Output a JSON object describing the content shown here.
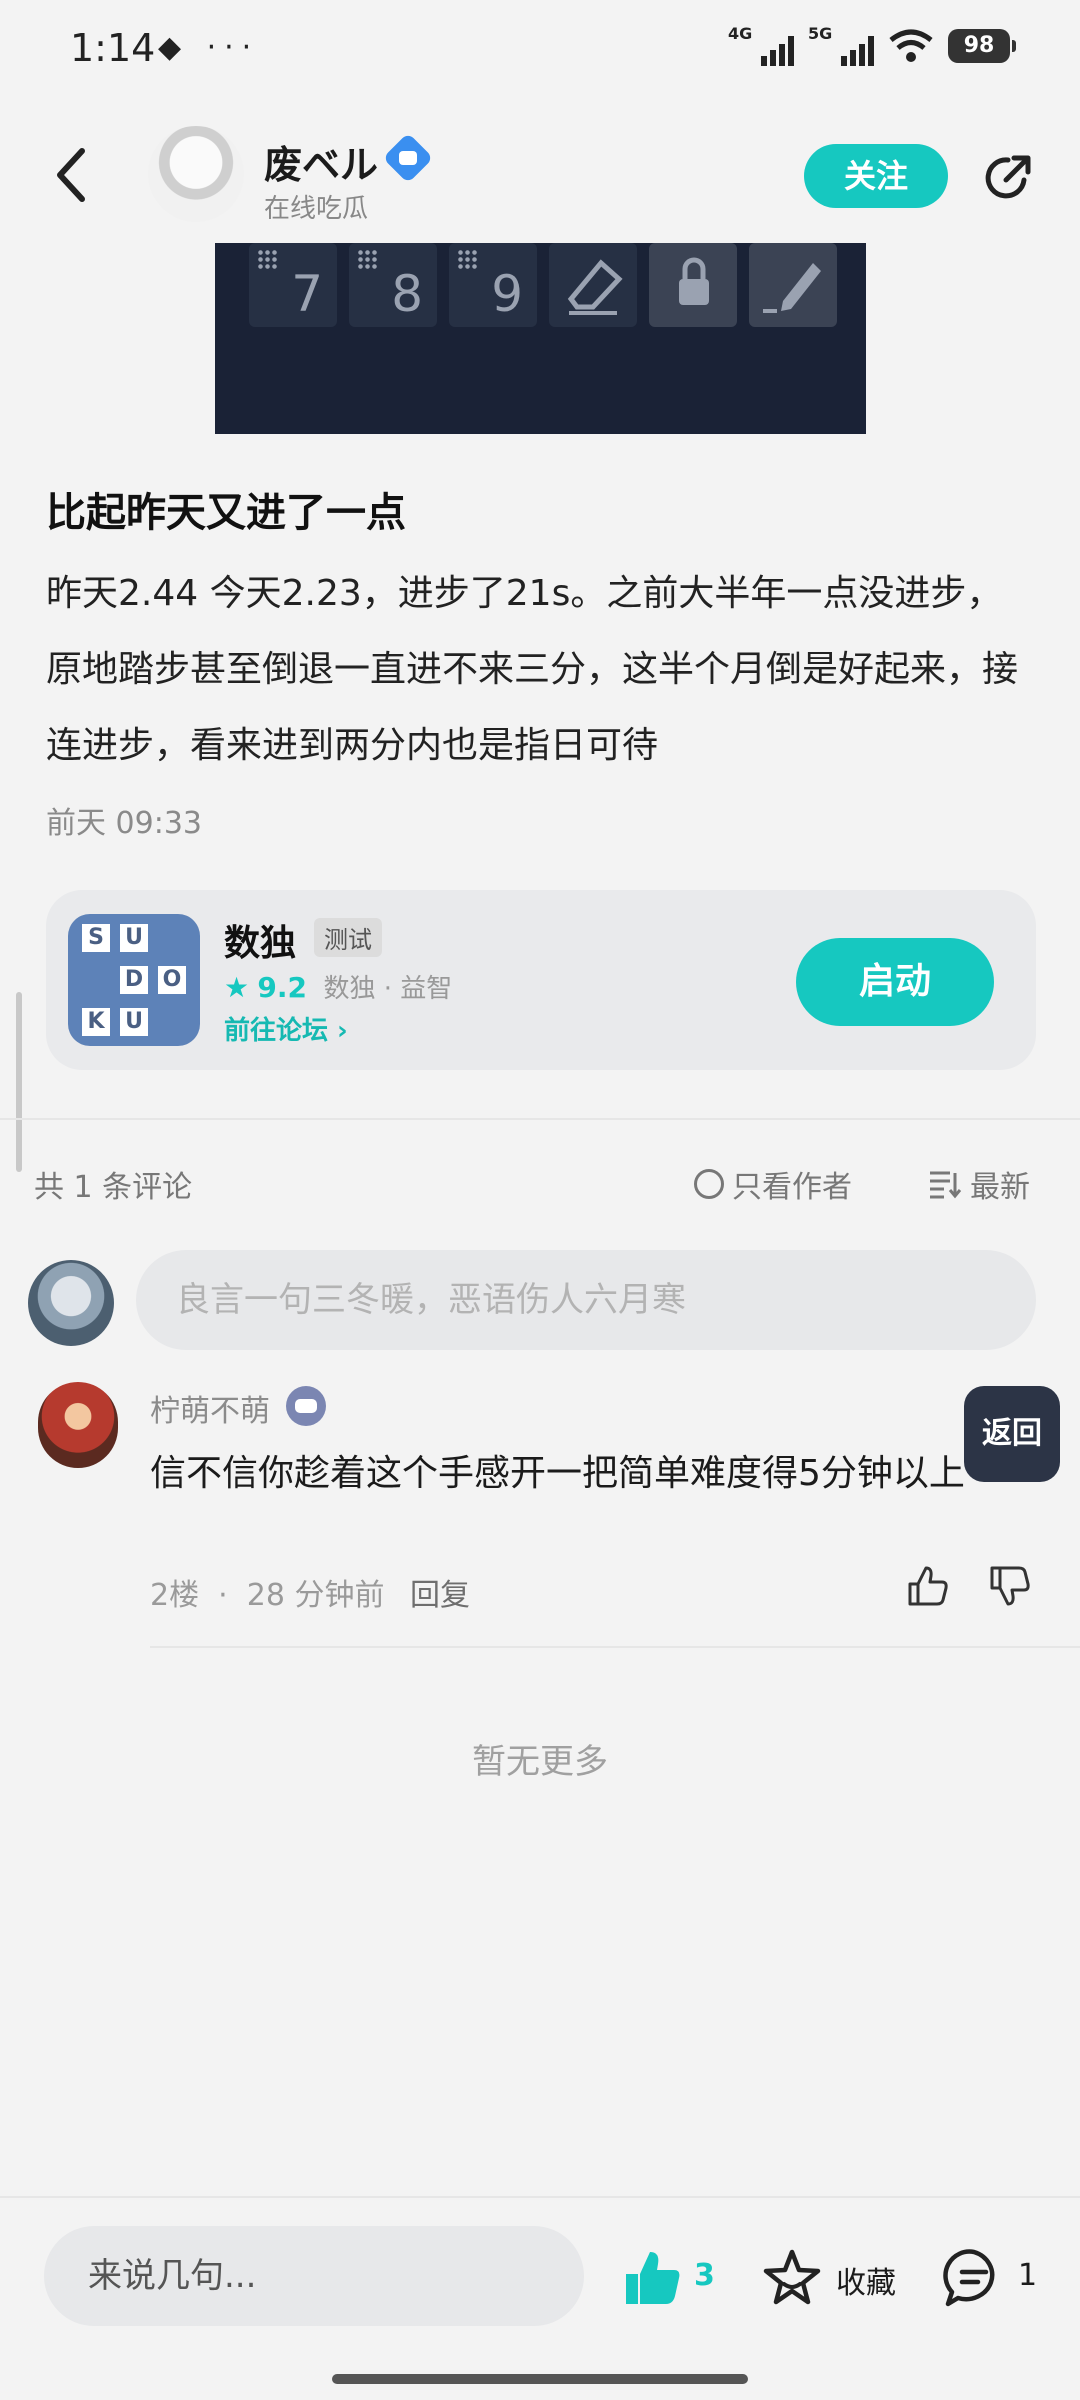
{
  "status_bar": {
    "time": "1:14",
    "left_icons": "◆ ···",
    "sig1_label": "4G",
    "sig2_label": "5G",
    "battery": "98"
  },
  "header": {
    "author_name": "废ベル",
    "author_sub": "在线吃瓜",
    "follow_label": "关注"
  },
  "post": {
    "image_tiles": [
      "7",
      "8",
      "9"
    ],
    "title": "比起昨天又进了一点",
    "body": "昨天2.44 今天2.23，进步了21s。之前大半年一点没进步，原地踏步甚至倒退一直进不来三分，这半个月倒是好起来，接连进步，看来进到两分内也是指日可待",
    "time": "前天 09:33"
  },
  "app_card": {
    "name": "数独",
    "tag": "测试",
    "rating": "9.2",
    "category": "数独 · 益智",
    "forum_link": "前往论坛 ›",
    "launch_label": "启动",
    "icon_letters": [
      "S",
      "U",
      "D",
      "O",
      "K",
      "U"
    ]
  },
  "comments": {
    "count_label": "共 1 条评论",
    "only_author_label": "只看作者",
    "sort_label": "最新",
    "input_placeholder": "良言一句三冬暖，恶语伤人六月寒",
    "items": [
      {
        "user": "柠萌不萌",
        "text": "信不信你趁着这个手感开一把简单难度得5分钟以上",
        "floor": "2楼",
        "time": "28 分钟前",
        "reply_label": "回复"
      }
    ],
    "no_more": "暂无更多"
  },
  "float_back_label": "返回",
  "bottom_bar": {
    "input_placeholder": "来说几句...",
    "like_count": "3",
    "favorite_label": "收藏",
    "comment_count": "1"
  },
  "colors": {
    "accent": "#16c8c0",
    "background": "#f3f3f3"
  }
}
